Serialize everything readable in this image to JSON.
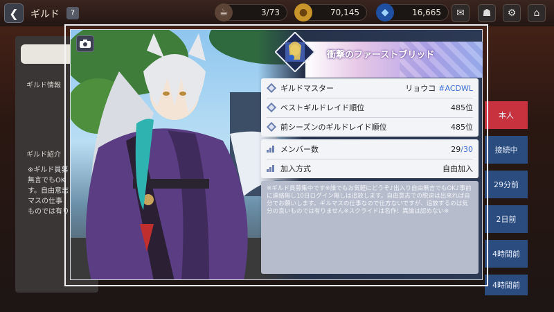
{
  "top_bar": {
    "title": "ギルド",
    "help": "?",
    "coffee": "3/73",
    "gold": "70,145",
    "gems": "16,665"
  },
  "background": {
    "guild_info_label": "ギルド情報",
    "guild_intro_label": "ギルド紹介",
    "intro_preview": "※ギルド員募 無言でもOK す。自由意志 マスの仕事 ものでは有り",
    "member_status": [
      "本人",
      "接続中",
      "29分前",
      "2日前",
      "4時間前",
      "4時間前"
    ]
  },
  "modal": {
    "guild_name": "衝撃のファーストブリッド",
    "rows": [
      {
        "label": "ギルドマスター",
        "value": "リョウコ",
        "tag": "#ACDWL"
      },
      {
        "label": "ベストギルドレイド順位",
        "value": "485位"
      },
      {
        "label": "前シーズンのギルドレイド順位",
        "value": "485位"
      }
    ],
    "members_label": "メンバー数",
    "members_current": "29",
    "members_max": "/30",
    "join_label": "加入方式",
    "join_value": "自由加入",
    "intro": "※ギルド員募集中です※誰でもお気軽にどうぞ♪出入り自由無言でもOK♪事前に連絡無し10日ログイン無しは追放します。自由意志での脱退は出来れば自分でお願いします。ギルマスの仕事なので仕方ないですが、追放するのは気分の良いものでは有りません※スクライドは名作！異論は認めない※"
  },
  "colors": {
    "accent_blue": "#3a6fd8",
    "row_icon": "#6c7fb3",
    "card_bg": "#f3f4f7",
    "intro_bg": "#b6bccb",
    "member_me": "#c8323f",
    "member_other": "#2b4c7e"
  },
  "icons": [
    "back-arrow-icon",
    "question-icon",
    "coffee-icon",
    "gold-coin-icon",
    "gem-icon",
    "mail-icon",
    "settings-gear-icon",
    "home-icon",
    "camera-icon",
    "diamond-bullet-icon",
    "bar-chart-icon"
  ]
}
